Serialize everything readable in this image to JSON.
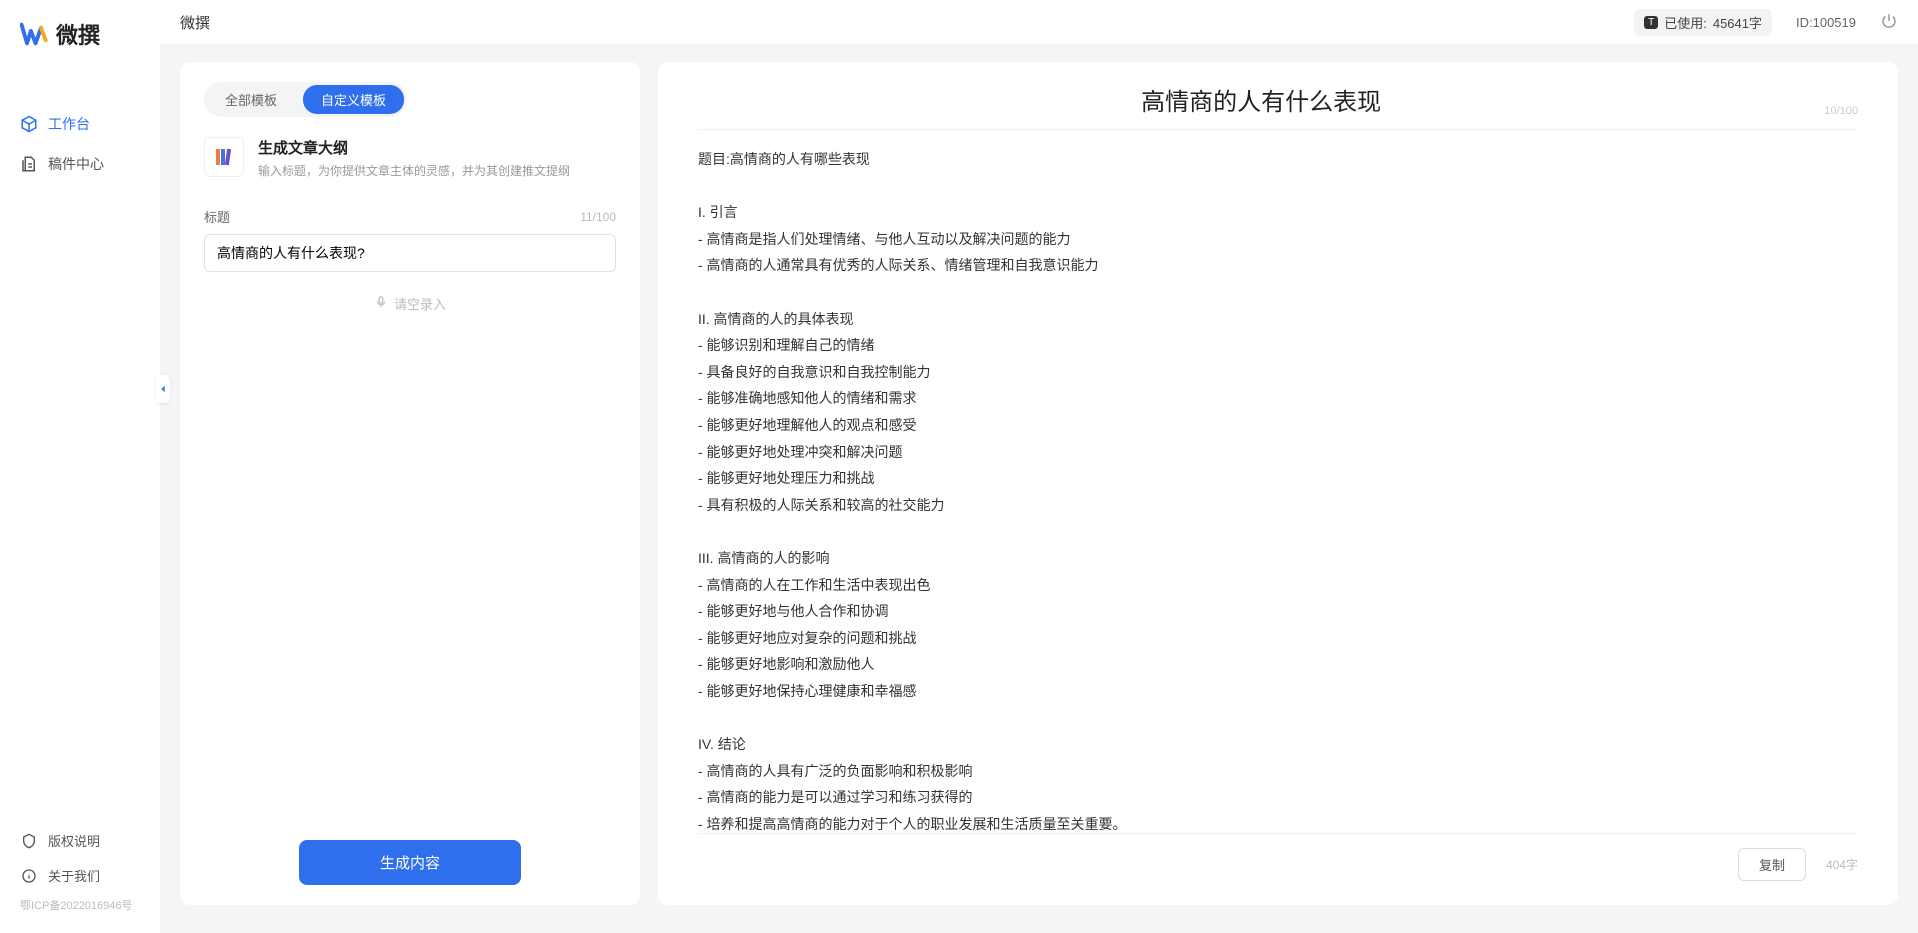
{
  "brand": {
    "name": "微撰"
  },
  "sidebar": {
    "nav": [
      {
        "label": "工作台",
        "active": true
      },
      {
        "label": "稿件中心",
        "active": false
      }
    ],
    "bottom": [
      {
        "label": "版权说明"
      },
      {
        "label": "关于我们"
      }
    ],
    "icp": "鄂ICP备2022016946号"
  },
  "topbar": {
    "title": "微撰",
    "usage_badge": "T",
    "usage_label": "已使用:",
    "usage_value": "45641字",
    "user_id": "ID:100519"
  },
  "left": {
    "tabs": [
      {
        "label": "全部模板",
        "active": false
      },
      {
        "label": "自定义模板",
        "active": true
      }
    ],
    "template": {
      "title": "生成文章大纲",
      "desc": "输入标题，为你提供文章主体的灵感，并为其创建推文提纲"
    },
    "field": {
      "label": "标题",
      "counter": "11/100",
      "value": "高情商的人有什么表现?"
    },
    "voice_hint": "请空录入",
    "generate": "生成内容"
  },
  "right": {
    "title": "高情商的人有什么表现",
    "title_counter": "10/100",
    "body": "题目:高情商的人有哪些表现\n\nI. 引言\n- 高情商是指人们处理情绪、与他人互动以及解决问题的能力\n- 高情商的人通常具有优秀的人际关系、情绪管理和自我意识能力\n\nII. 高情商的人的具体表现\n- 能够识别和理解自己的情绪\n- 具备良好的自我意识和自我控制能力\n- 能够准确地感知他人的情绪和需求\n- 能够更好地理解他人的观点和感受\n- 能够更好地处理冲突和解决问题\n- 能够更好地处理压力和挑战\n- 具有积极的人际关系和较高的社交能力\n\nIII. 高情商的人的影响\n- 高情商的人在工作和生活中表现出色\n- 能够更好地与他人合作和协调\n- 能够更好地应对复杂的问题和挑战\n- 能够更好地影响和激励他人\n- 能够更好地保持心理健康和幸福感\n\nIV. 结论\n- 高情商的人具有广泛的负面影响和积极影响\n- 高情商的能力是可以通过学习和练习获得的\n- 培养和提高高情商的能力对于个人的职业发展和生活质量至关重要。",
    "copy": "复制",
    "word_count": "404字"
  }
}
